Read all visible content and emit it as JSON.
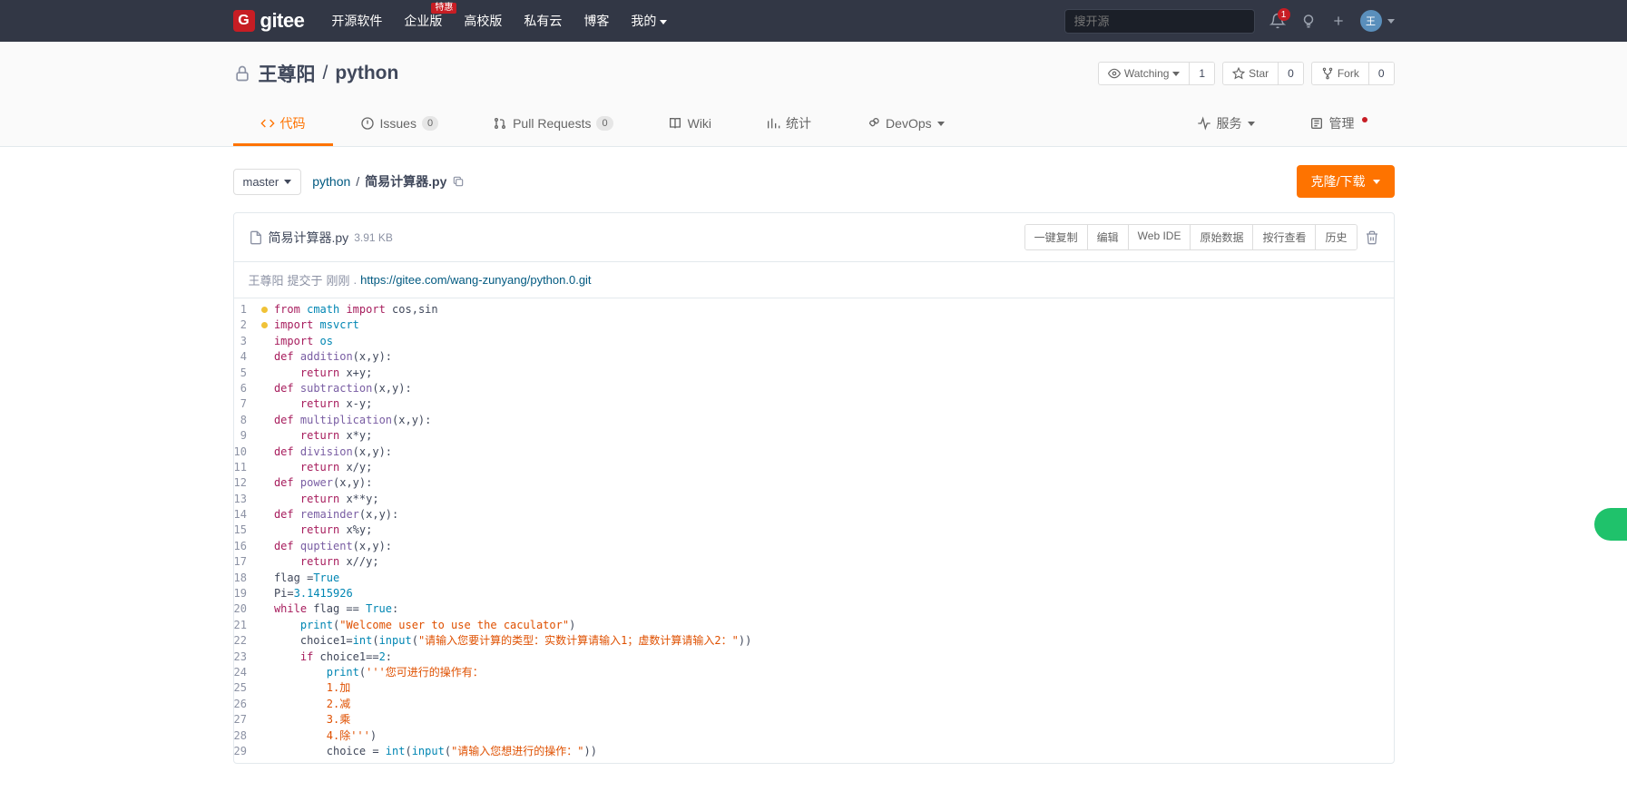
{
  "header": {
    "logo_text": "gitee",
    "nav": [
      "开源软件",
      "企业版",
      "高校版",
      "私有云",
      "博客",
      "我的"
    ],
    "nav_badge": "特惠",
    "search_placeholder": "搜开源",
    "notif_count": "1",
    "avatar_initial": "王"
  },
  "repo": {
    "owner": "王尊阳",
    "name": "python",
    "watching_label": "Watching",
    "watching_count": "1",
    "star_label": "Star",
    "star_count": "0",
    "fork_label": "Fork",
    "fork_count": "0"
  },
  "tabs": {
    "code": "代码",
    "issues": "Issues",
    "issues_count": "0",
    "pr": "Pull Requests",
    "pr_count": "0",
    "wiki": "Wiki",
    "stats": "统计",
    "devops": "DevOps",
    "service": "服务",
    "manage": "管理"
  },
  "branch": "master",
  "breadcrumb": {
    "root": "python",
    "file": "简易计算器.py"
  },
  "clone_label": "克隆/下载",
  "file": {
    "name": "简易计算器.py",
    "size": "3.91 KB",
    "tools": [
      "一键复制",
      "编辑",
      "Web IDE",
      "原始数据",
      "按行查看",
      "历史"
    ],
    "commit_author": "王尊阳",
    "commit_action": "提交于",
    "commit_time": "刚刚",
    "commit_url_text": "https://gitee.com/wang-zunyang/python.0.git"
  },
  "code": {
    "lines": [
      {
        "n": 1,
        "lint": true,
        "tokens": [
          [
            "op",
            "from"
          ],
          [
            "",
            " "
          ],
          [
            "kw",
            "cmath"
          ],
          [
            "",
            " "
          ],
          [
            "op",
            "import"
          ],
          [
            "",
            " "
          ],
          [
            "",
            "cos,sin"
          ]
        ]
      },
      {
        "n": 2,
        "lint": true,
        "tokens": [
          [
            "op",
            "import"
          ],
          [
            "",
            " "
          ],
          [
            "kw",
            "msvcrt"
          ]
        ]
      },
      {
        "n": 3,
        "tokens": [
          [
            "op",
            "import"
          ],
          [
            "",
            " "
          ],
          [
            "kw",
            "os"
          ]
        ]
      },
      {
        "n": 4,
        "tokens": [
          [
            "op",
            "def"
          ],
          [
            "",
            " "
          ],
          [
            "fn",
            "addition"
          ],
          [
            "",
            "(x,y):"
          ]
        ]
      },
      {
        "n": 5,
        "tokens": [
          [
            "",
            "    "
          ],
          [
            "op",
            "return"
          ],
          [
            "",
            " x+y;"
          ]
        ]
      },
      {
        "n": 6,
        "tokens": [
          [
            "op",
            "def"
          ],
          [
            "",
            " "
          ],
          [
            "fn",
            "subtraction"
          ],
          [
            "",
            "(x,y):"
          ]
        ]
      },
      {
        "n": 7,
        "tokens": [
          [
            "",
            "    "
          ],
          [
            "op",
            "return"
          ],
          [
            "",
            " x-y;"
          ]
        ]
      },
      {
        "n": 8,
        "tokens": [
          [
            "op",
            "def"
          ],
          [
            "",
            " "
          ],
          [
            "fn",
            "multiplication"
          ],
          [
            "",
            "(x,y):"
          ]
        ]
      },
      {
        "n": 9,
        "tokens": [
          [
            "",
            "    "
          ],
          [
            "op",
            "return"
          ],
          [
            "",
            " x*y;"
          ]
        ]
      },
      {
        "n": 10,
        "tokens": [
          [
            "op",
            "def"
          ],
          [
            "",
            " "
          ],
          [
            "fn",
            "division"
          ],
          [
            "",
            "(x,y):"
          ]
        ]
      },
      {
        "n": 11,
        "tokens": [
          [
            "",
            "    "
          ],
          [
            "op",
            "return"
          ],
          [
            "",
            " x/y;"
          ]
        ]
      },
      {
        "n": 12,
        "tokens": [
          [
            "op",
            "def"
          ],
          [
            "",
            " "
          ],
          [
            "fn",
            "power"
          ],
          [
            "",
            "(x,y):"
          ]
        ]
      },
      {
        "n": 13,
        "tokens": [
          [
            "",
            "    "
          ],
          [
            "op",
            "return"
          ],
          [
            "",
            " x**y;"
          ]
        ]
      },
      {
        "n": 14,
        "tokens": [
          [
            "op",
            "def"
          ],
          [
            "",
            " "
          ],
          [
            "fn",
            "remainder"
          ],
          [
            "",
            "(x,y):"
          ]
        ]
      },
      {
        "n": 15,
        "tokens": [
          [
            "",
            "    "
          ],
          [
            "op",
            "return"
          ],
          [
            "",
            " x%y;"
          ]
        ]
      },
      {
        "n": 16,
        "tokens": [
          [
            "op",
            "def"
          ],
          [
            "",
            " "
          ],
          [
            "fn",
            "quptient"
          ],
          [
            "",
            "(x,y):"
          ]
        ]
      },
      {
        "n": 17,
        "tokens": [
          [
            "",
            "    "
          ],
          [
            "op",
            "return"
          ],
          [
            "",
            " x//y;"
          ]
        ]
      },
      {
        "n": 18,
        "tokens": [
          [
            "",
            "flag ="
          ],
          [
            "bool",
            "True"
          ]
        ]
      },
      {
        "n": 19,
        "tokens": [
          [
            "",
            "Pi="
          ],
          [
            "num",
            "3.1415926"
          ]
        ]
      },
      {
        "n": 20,
        "tokens": [
          [
            "op",
            "while"
          ],
          [
            "",
            " flag == "
          ],
          [
            "bool",
            "True"
          ],
          [
            "",
            ":"
          ]
        ]
      },
      {
        "n": 21,
        "tokens": [
          [
            "",
            "    "
          ],
          [
            "bool",
            "print"
          ],
          [
            "",
            "("
          ],
          [
            "str",
            "\"Welcome user to use the caculator\""
          ],
          [
            "",
            ")"
          ]
        ]
      },
      {
        "n": 22,
        "tokens": [
          [
            "",
            "    choice1="
          ],
          [
            "bool",
            "int"
          ],
          [
            "",
            "("
          ],
          [
            "bool",
            "input"
          ],
          [
            "",
            "("
          ],
          [
            "str",
            "\"请输入您要计算的类型：实数计算请输入1；虚数计算请输入2：\""
          ],
          [
            "",
            "))"
          ]
        ]
      },
      {
        "n": 23,
        "tokens": [
          [
            "",
            "    "
          ],
          [
            "op",
            "if"
          ],
          [
            "",
            " choice1=="
          ],
          [
            "num",
            "2"
          ],
          [
            "",
            ":"
          ]
        ]
      },
      {
        "n": 24,
        "tokens": [
          [
            "",
            "        "
          ],
          [
            "bool",
            "print"
          ],
          [
            "",
            "("
          ],
          [
            "str",
            "'''您可进行的操作有："
          ]
        ]
      },
      {
        "n": 25,
        "tokens": [
          [
            "",
            "        "
          ],
          [
            "str",
            "1.加"
          ]
        ]
      },
      {
        "n": 26,
        "tokens": [
          [
            "",
            "        "
          ],
          [
            "str",
            "2.减"
          ]
        ]
      },
      {
        "n": 27,
        "tokens": [
          [
            "",
            "        "
          ],
          [
            "str",
            "3.乘"
          ]
        ]
      },
      {
        "n": 28,
        "tokens": [
          [
            "",
            "        "
          ],
          [
            "str",
            "4.除'''"
          ],
          [
            "",
            ")"
          ]
        ]
      },
      {
        "n": 29,
        "tokens": [
          [
            "",
            "        choice = "
          ],
          [
            "bool",
            "int"
          ],
          [
            "",
            "("
          ],
          [
            "bool",
            "input"
          ],
          [
            "",
            "("
          ],
          [
            "str",
            "\"请输入您想进行的操作：\""
          ],
          [
            "",
            "))"
          ]
        ]
      }
    ]
  }
}
